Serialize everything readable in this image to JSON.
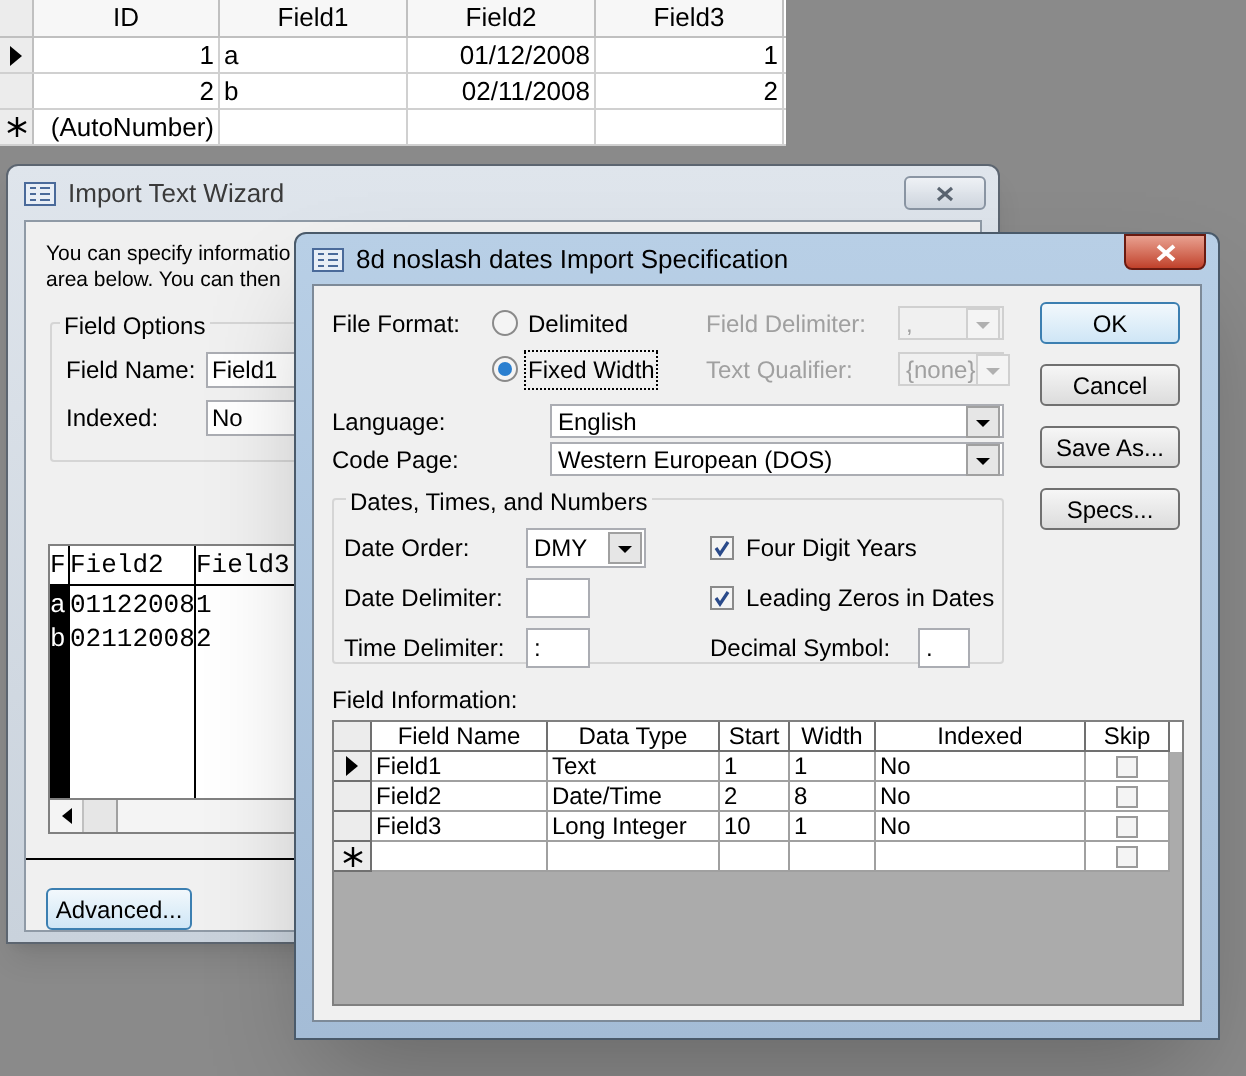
{
  "datasheet": {
    "columns": [
      "ID",
      "Field1",
      "Field2",
      "Field3"
    ],
    "rows": [
      {
        "kind": "record",
        "current": true,
        "cells": [
          "1",
          "a",
          "01/12/2008",
          "1"
        ]
      },
      {
        "kind": "record",
        "current": false,
        "cells": [
          "2",
          "b",
          "02/11/2008",
          "2"
        ]
      },
      {
        "kind": "new",
        "cells": [
          "(AutoNumber)"
        ]
      }
    ]
  },
  "wizard": {
    "title": "Import Text Wizard",
    "intro_lines": [
      "You can specify informatio",
      "area below. You can then"
    ],
    "field_options": {
      "legend": "Field Options",
      "field_name_label": "Field Name:",
      "field_name_value": "Field1",
      "indexed_label": "Indexed:",
      "indexed_value": "No"
    },
    "preview": {
      "columns": [
        "F",
        "Field2",
        "Field3"
      ],
      "rows": [
        [
          "a",
          "01122008",
          "1"
        ],
        [
          "b",
          "02112008",
          "2"
        ]
      ]
    },
    "advanced_button": "Advanced..."
  },
  "spec": {
    "title": "8d noslash dates Import Specification",
    "file_format_label": "File Format:",
    "formats": [
      {
        "label": "Delimited",
        "selected": false
      },
      {
        "label": "Fixed Width",
        "selected": true
      }
    ],
    "field_delimiter": {
      "label": "Field Delimiter:",
      "value": ",",
      "disabled": true
    },
    "text_qualifier": {
      "label": "Text Qualifier:",
      "value": "{none}",
      "disabled": true
    },
    "language": {
      "label": "Language:",
      "value": "English"
    },
    "code_page": {
      "label": "Code Page:",
      "value": "Western European (DOS)"
    },
    "dates_group": {
      "legend": "Dates, Times, and Numbers",
      "date_order": {
        "label": "Date Order:",
        "value": "DMY"
      },
      "date_delimiter": {
        "label": "Date Delimiter:"
      },
      "time_delimiter": {
        "label": "Time Delimiter:",
        "value": ":"
      },
      "four_digit_years": {
        "label": "Four Digit Years",
        "checked": true
      },
      "leading_zeros": {
        "label": "Leading Zeros in Dates",
        "checked": true
      },
      "decimal_symbol": {
        "label": "Decimal Symbol:",
        "value": "."
      }
    },
    "buttons": [
      {
        "label": "OK",
        "default": true
      },
      {
        "label": "Cancel",
        "default": false
      },
      {
        "label": "Save As...",
        "default": false
      },
      {
        "label": "Specs...",
        "default": false
      }
    ],
    "field_info": {
      "label": "Field Information:",
      "columns": [
        "Field Name",
        "Data Type",
        "Start",
        "Width",
        "Indexed",
        "Skip"
      ],
      "rows": [
        {
          "kind": "record",
          "current": true,
          "cells": [
            "Field1",
            "Text",
            "1",
            "1",
            "No"
          ],
          "skip": false
        },
        {
          "kind": "record",
          "current": false,
          "cells": [
            "Field2",
            "Date/Time",
            "2",
            "8",
            "No"
          ],
          "skip": false
        },
        {
          "kind": "record",
          "current": false,
          "cells": [
            "Field3",
            "Long Integer",
            "10",
            "1",
            "No"
          ],
          "skip": false
        },
        {
          "kind": "new",
          "skip": false
        }
      ]
    }
  }
}
